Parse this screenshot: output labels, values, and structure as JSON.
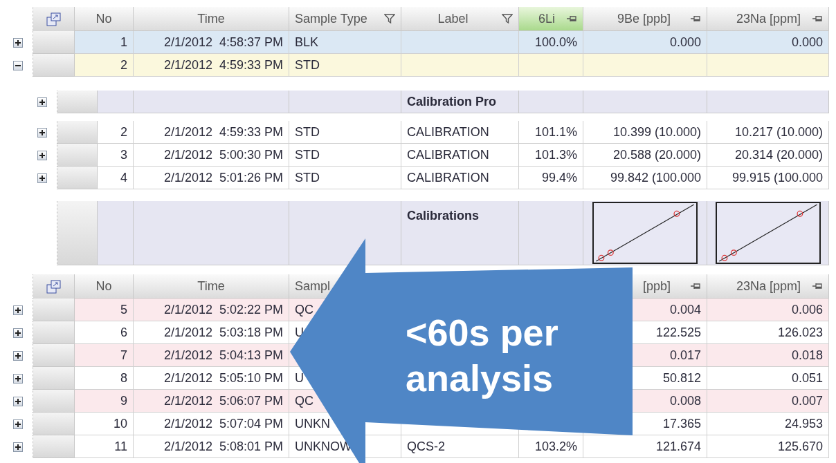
{
  "grid": {
    "columns": [
      {
        "label": "No",
        "kind": "plain",
        "selected": false
      },
      {
        "label": "Time",
        "kind": "plain",
        "selected": false
      },
      {
        "label": "Sample Type",
        "kind": "filter",
        "selected": false
      },
      {
        "label": "Label",
        "kind": "filter",
        "selected": false
      },
      {
        "label": "6Li",
        "kind": "pin",
        "selected": true
      },
      {
        "label": "9Be [ppb]",
        "kind": "pin",
        "selected": false
      },
      {
        "label": "23Na [ppm]",
        "kind": "pin",
        "selected": false
      }
    ],
    "rows": [
      {
        "expanded": false,
        "color": "#dbe8f4",
        "no": "1",
        "time": "2/1/2012  4:58:37 PM",
        "sample_type": "BLK",
        "li": "100.0%",
        "be": "0.000",
        "na": "0.000"
      },
      {
        "expanded": true,
        "color": "#fbf8dd",
        "no": "2",
        "time": "2/1/2012  4:59:33 PM",
        "sample_type": "STD"
      }
    ]
  },
  "detail": {
    "group_row": {
      "expanded": false,
      "label": "Calibration Pro"
    },
    "rows": [
      {
        "expanded": false,
        "no": "2",
        "time": "2/1/2012  4:59:33 PM",
        "sample_type": "STD",
        "label": "CALIBRATION",
        "li": "101.1%",
        "be": "10.399 (10.000)",
        "na": "10.217 (10.000)"
      },
      {
        "expanded": false,
        "no": "3",
        "time": "2/1/2012  5:00:30 PM",
        "sample_type": "STD",
        "label": "CALIBRATION",
        "li": "101.3%",
        "be": "20.588 (20.000)",
        "na": "20.314 (20.000)"
      },
      {
        "expanded": false,
        "no": "4",
        "time": "2/1/2012  5:01:26 PM",
        "sample_type": "STD",
        "label": "CALIBRATION",
        "li": "99.4%",
        "be": "99.842 (100.000",
        "na": "99.915 (100.000"
      }
    ],
    "summary_row": {
      "label": "Calibrations",
      "curves": [
        {
          "kind": "curve"
        },
        {
          "kind": "curve"
        }
      ]
    }
  },
  "lower_grid": {
    "columns": [
      {
        "label": "No",
        "kind": "plain"
      },
      {
        "label": "Time",
        "kind": "plain"
      },
      {
        "label": "Sampl",
        "kind": "plain"
      },
      {
        "kind": "plain"
      },
      {
        "kind": "plain"
      },
      {
        "label": "[ppb]",
        "kind": "pin"
      },
      {
        "label": "23Na [ppm]",
        "kind": "pin"
      }
    ],
    "rows": [
      {
        "expanded": false,
        "color": "#fbe9ec",
        "no": "5",
        "time": "2/1/2012  5:02:22 PM",
        "sample_type": "QC",
        "be": "0.004",
        "na": "0.006"
      },
      {
        "expanded": false,
        "color": "#ffffff",
        "no": "6",
        "time": "2/1/2012  5:03:18 PM",
        "sample_type": "U",
        "be": "122.525",
        "na": "126.023"
      },
      {
        "expanded": false,
        "color": "#fbe9ec",
        "no": "7",
        "time": "2/1/2012  5:04:13 PM",
        "be": "0.017",
        "na": "0.018"
      },
      {
        "expanded": false,
        "color": "#ffffff",
        "no": "8",
        "time": "2/1/2012  5:05:10 PM",
        "sample_type": "U",
        "be": "50.812",
        "na": "0.051"
      },
      {
        "expanded": false,
        "color": "#fbe9ec",
        "no": "9",
        "time": "2/1/2012  5:06:07 PM",
        "sample_type": "QC",
        "be": "0.008",
        "na": "0.007"
      },
      {
        "expanded": false,
        "color": "#ffffff",
        "no": "10",
        "time": "2/1/2012  5:07:04 PM",
        "sample_type": "UNKN",
        "be": "17.365",
        "na": "24.953"
      },
      {
        "expanded": false,
        "color": "#ffffff",
        "no": "11",
        "time": "2/1/2012  5:08:01 PM",
        "sample_type": "UNKNOW",
        "label": "QCS-2",
        "li": "103.2%",
        "be": "121.674",
        "na": "125.670"
      }
    ]
  },
  "callout": {
    "text": "<60s per analysis"
  }
}
